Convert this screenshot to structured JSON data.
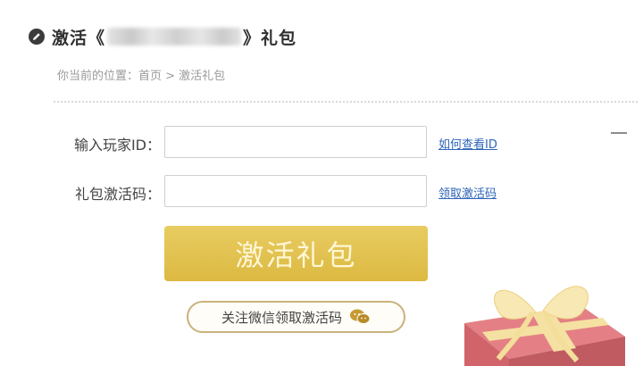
{
  "header": {
    "title_prefix": "激活《",
    "title_suffix": "》礼包",
    "icon": "pencil-circle-icon"
  },
  "breadcrumb": {
    "text": "你当前的位置：首页 > 激活礼包"
  },
  "form": {
    "player_id": {
      "label": "输入玩家ID：",
      "value": "",
      "link": "如何查看ID"
    },
    "gift_code": {
      "label": "礼包激活码：",
      "value": "",
      "link": "领取激活码"
    },
    "submit_label": "激活礼包"
  },
  "wechat": {
    "label": "关注微信领取激活码",
    "icon": "wechat-icon"
  },
  "collapse_icon": "minus-icon",
  "colors": {
    "button": "#dcb941",
    "link": "#2f64b8",
    "pill_border": "#c9b27a",
    "gift_red": "#d9525a",
    "ribbon": "#f2d98a"
  }
}
